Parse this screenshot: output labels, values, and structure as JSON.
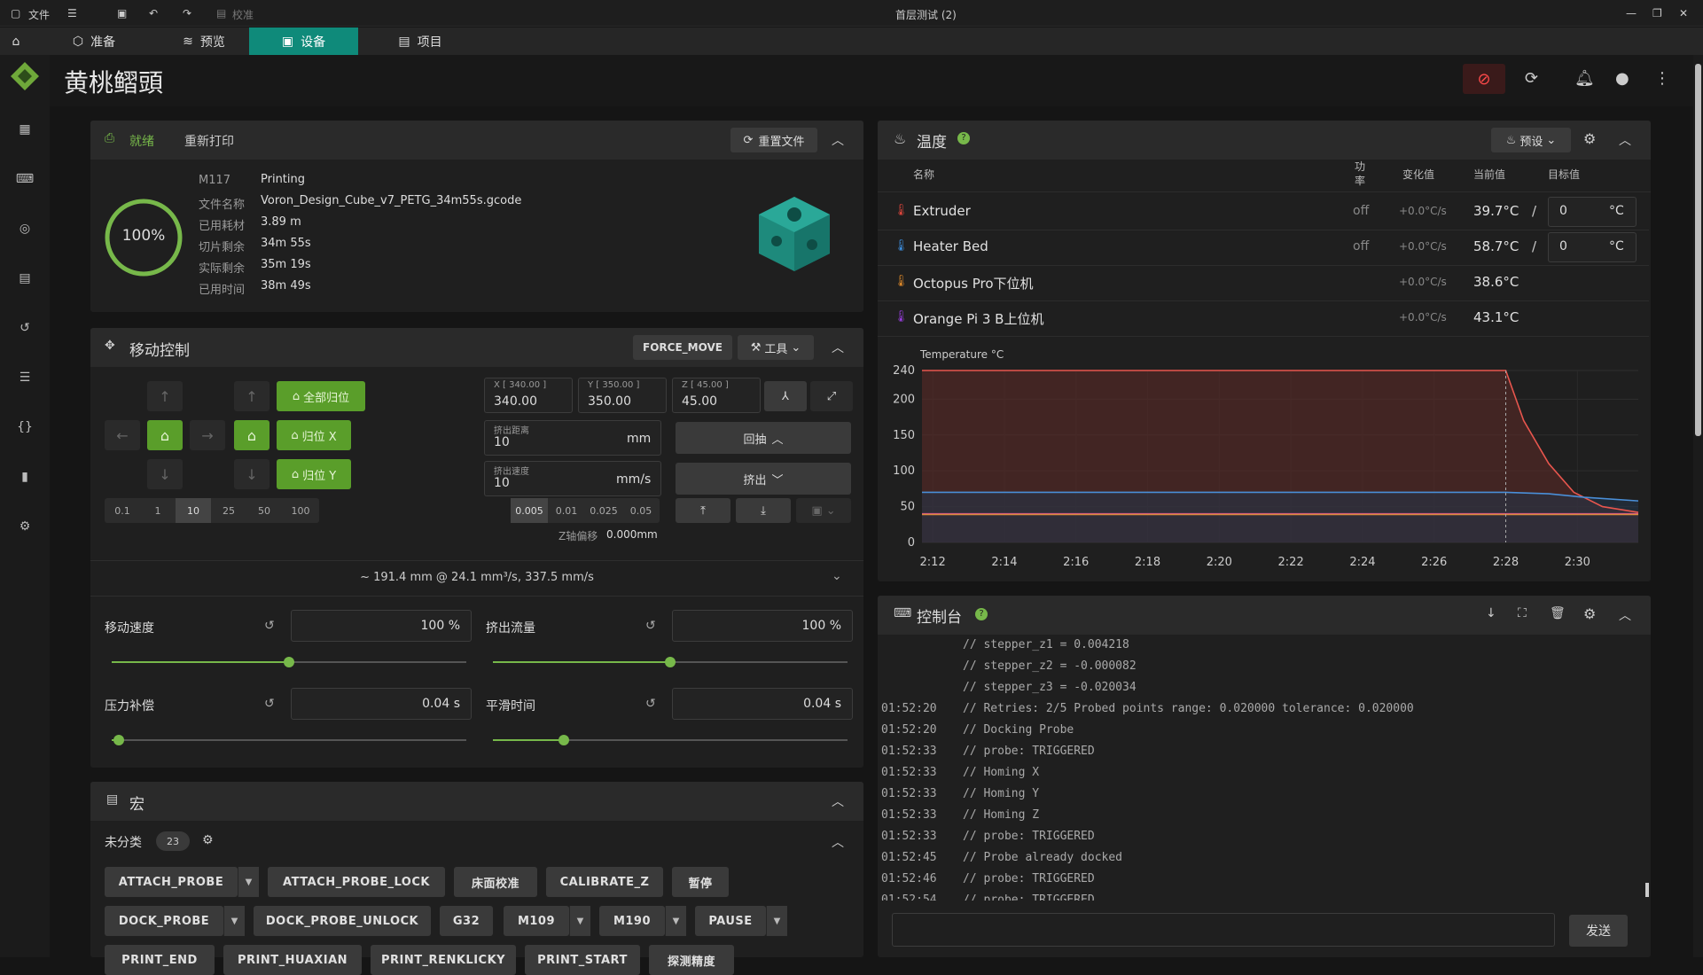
{
  "titlebar": {
    "file_label": "文件",
    "calibrate_label": "校准",
    "window_title": "首层测试 (2)"
  },
  "tabs": [
    {
      "label": "准备"
    },
    {
      "label": "预览"
    },
    {
      "label": "设备"
    },
    {
      "label": "项目"
    }
  ],
  "header": {
    "printer_name": "黄桃鳛頭"
  },
  "status_panel": {
    "state": "就绪",
    "reprint": "重新打印",
    "reset_file": "重置文件",
    "progress_text": "100%",
    "progress_value": 1.0,
    "gcode_cmd": "M117",
    "gcode_value": "Printing",
    "rows": [
      {
        "label": "文件名称",
        "value": "Voron_Design_Cube_v7_PETG_34m55s.gcode"
      },
      {
        "label": "已用耗材",
        "value": "3.89 m"
      },
      {
        "label": "切片剩余",
        "value": "34m 55s"
      },
      {
        "label": "实际剩余",
        "value": "35m 19s"
      },
      {
        "label": "已用时间",
        "value": "38m 49s"
      }
    ]
  },
  "motion": {
    "title": "移动控制",
    "force_move": "FORCE_MOVE",
    "tools": "工具",
    "home_all": "全部归位",
    "home_x": "归位 X",
    "home_y": "归位 Y",
    "steps": [
      "0.1",
      "1",
      "10",
      "25",
      "50",
      "100"
    ],
    "x_label": "X [ 340.00 ]",
    "x_value": "340.00",
    "y_label": "Y [ 350.00 ]",
    "y_value": "350.00",
    "z_label": "Z [ 45.00 ]",
    "z_value": "45.00",
    "extrude_dist_label": "挤出距离",
    "extrude_dist": "10",
    "extrude_dist_unit": "mm",
    "extrude_speed_label": "挤出速度",
    "extrude_speed": "10",
    "extrude_speed_unit": "mm/s",
    "retract": "回抽",
    "extrude": "挤出",
    "z_steps": [
      "0.005",
      "0.01",
      "0.025",
      "0.05"
    ],
    "z_offset_label": "Z轴偏移",
    "z_offset_value": "0.000mm",
    "summary": "~ 191.4 mm @ 24.1 mm³/s, 337.5 mm/s"
  },
  "tuning": {
    "speed_label": "移动速度",
    "speed_value": "100 %",
    "speed_level": 0.5,
    "flow_label": "挤出流量",
    "flow_value": "100 %",
    "flow_level": 0.5,
    "pa_label": "压力补偿",
    "pa_value": "0.04 s",
    "pa_level": 0.02,
    "smooth_label": "平滑时间",
    "smooth_value": "0.04 s",
    "smooth_level": 0.2
  },
  "macros": {
    "title": "宏",
    "group": "未分类",
    "count": "23",
    "row1": [
      "ATTACH_PROBE",
      "ATTACH_PROBE_LOCK",
      "床面校准",
      "CALIBRATE_Z",
      "暂停"
    ],
    "row2": [
      "DOCK_PROBE",
      "DOCK_PROBE_UNLOCK",
      "G32",
      "M109",
      "M190",
      "PAUSE"
    ],
    "row3": [
      "PRINT_END",
      "PRINT_HUAXIAN",
      "PRINT_RENKLICKY",
      "PRINT_START",
      "探测精度"
    ]
  },
  "temperature": {
    "title": "温度",
    "presets": "预设",
    "headers": {
      "name": "名称",
      "power": "功率",
      "rate": "变化值",
      "current": "当前值",
      "target": "目标值"
    },
    "rows": [
      {
        "name": "Extruder",
        "power": "off",
        "rate": "+0.0°C/s",
        "current": "39.7°C",
        "target": "0",
        "unit": "°C",
        "color": "#e0463c"
      },
      {
        "name": "Heater Bed",
        "power": "off",
        "rate": "+0.0°C/s",
        "current": "58.7°C",
        "target": "0",
        "unit": "°C",
        "color": "#3d8fe0"
      },
      {
        "name": "Octopus Pro下位机",
        "power": "",
        "rate": "+0.0°C/s",
        "current": "38.6°C",
        "target": "",
        "unit": "",
        "color": "#e08a2a"
      },
      {
        "name": "Orange Pi 3 B上位机",
        "power": "",
        "rate": "+0.0°C/s",
        "current": "43.1°C",
        "target": "",
        "unit": "",
        "color": "#9a3de0"
      }
    ]
  },
  "chart_data": {
    "type": "line",
    "title": "Temperature °C",
    "x_ticks": [
      "2:12",
      "2:14",
      "2:16",
      "2:18",
      "2:20",
      "2:22",
      "2:24",
      "2:26",
      "2:28",
      "2:30"
    ],
    "y_ticks": [
      0,
      50,
      100,
      150,
      200,
      240
    ],
    "ylim": [
      0,
      240
    ],
    "xlim": [
      0,
      20
    ],
    "series": [
      {
        "color": "#e8564e",
        "x": [
          0,
          16.3,
          16.8,
          17.5,
          18.2,
          19,
          20
        ],
        "y": [
          240,
          240,
          170,
          110,
          70,
          50,
          42
        ]
      },
      {
        "color": "#4a8fd8",
        "x": [
          0,
          16.3,
          17.5,
          18.5,
          20
        ],
        "y": [
          70,
          70,
          68,
          63,
          58
        ]
      },
      {
        "color": "#d84aa0",
        "x": [
          0,
          20
        ],
        "y": [
          40,
          40
        ]
      },
      {
        "color": "#d88a3a",
        "x": [
          0,
          20
        ],
        "y": [
          39,
          39
        ]
      }
    ]
  },
  "console": {
    "title": "控制台",
    "send": "发送",
    "lines": [
      {
        "time": "",
        "text": "// stepper_z1 = 0.004218"
      },
      {
        "time": "",
        "text": "// stepper_z2 = -0.000082"
      },
      {
        "time": "",
        "text": "// stepper_z3 = -0.020034"
      },
      {
        "time": "01:52:20",
        "text": "// Retries: 2/5 Probed points range: 0.020000 tolerance: 0.020000"
      },
      {
        "time": "01:52:20",
        "text": "// Docking Probe"
      },
      {
        "time": "01:52:33",
        "text": "// probe: TRIGGERED"
      },
      {
        "time": "01:52:33",
        "text": "// Homing X"
      },
      {
        "time": "01:52:33",
        "text": "// Homing Y"
      },
      {
        "time": "01:52:33",
        "text": "// Homing Z"
      },
      {
        "time": "01:52:33",
        "text": "// probe: TRIGGERED"
      },
      {
        "time": "01:52:45",
        "text": "// Probe already docked"
      },
      {
        "time": "01:52:46",
        "text": "// probe: TRIGGERED"
      },
      {
        "time": "01:52:54",
        "text": "// probe: TRIGGERED"
      }
    ]
  }
}
